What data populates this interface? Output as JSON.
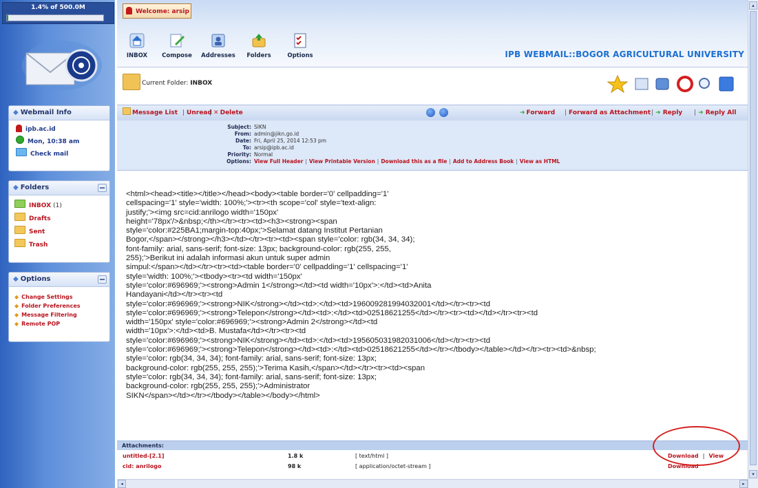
{
  "quota": {
    "text": "1.4% of 500.0M",
    "used_fraction": 0.014
  },
  "sidebar": {
    "webmail_info": {
      "title": "Webmail Info",
      "host": "ipb.ac.id",
      "datetime": "Mon, 10:38 am",
      "check_mail": "Check mail"
    },
    "folders": {
      "title": "Folders",
      "items": [
        {
          "label": "INBOX",
          "count": "(1)"
        },
        {
          "label": "Drafts"
        },
        {
          "label": "Sent"
        },
        {
          "label": "Trash"
        }
      ]
    },
    "options": {
      "title": "Options",
      "items": [
        {
          "label": "Change Settings"
        },
        {
          "label": "Folder Preferences"
        },
        {
          "label": "Message Filtering"
        },
        {
          "label": "Remote POP"
        }
      ]
    }
  },
  "header": {
    "welcome": "Welcome: arsip",
    "nav": [
      {
        "label": "INBOX",
        "icon": "house-icon"
      },
      {
        "label": "Compose",
        "icon": "compose-icon"
      },
      {
        "label": "Addresses",
        "icon": "addressbook-icon"
      },
      {
        "label": "Folders",
        "icon": "folders-icon"
      },
      {
        "label": "Options",
        "icon": "options-icon"
      }
    ],
    "university_title": "IPB WEBMAIL::BOGOR AGRICULTURAL UNIVERSITY"
  },
  "folder_bar": {
    "label": "Current Folder:",
    "folder": "INBOX"
  },
  "msg_toolbar": {
    "message_list": "Message List",
    "unread": "Unread",
    "delete": "Delete",
    "forward": "Forward",
    "forward_attachment": "Forward as Attachment",
    "reply": "Reply",
    "reply_all": "Reply All"
  },
  "msg_headers": {
    "subject_label": "Subject:",
    "subject": "SIKN",
    "from_label": "From:",
    "from": "admin@jikn.go.id",
    "date_label": "Date:",
    "date": "Fri, April 25, 2014 12:53 pm",
    "to_label": "To:",
    "to": "arsip@ipb.ac.id",
    "priority_label": "Priority:",
    "priority": "Normal",
    "options_label": "Options:",
    "options": [
      "View Full Header",
      "View Printable Version",
      "Download this as a file",
      "Add to Address Book",
      "View as HTML"
    ]
  },
  "message_body": [
    "<html><head><title></title></head><body><table border='0' cellpadding='1'",
    "cellspacing='1' style='width: 100%;'><tr><th scope='col' style='text-align:",
    "justify;'><img src=cid:anrilogo width='150px'",
    "height='78px'/>&nbsp;</th></tr><tr><td><h3><strong><span",
    "style='color:#225BA1;margin-top:40px;'>Selamat datang Institut Pertanian",
    "Bogor,</span></strong></h3></td></tr><tr><td><span style='color: rgb(34, 34, 34);",
    "font-family: arial, sans-serif; font-size: 13px; background-color: rgb(255, 255,",
    "255);'>Berikut ini adalah informasi akun untuk super admin",
    "simpul:</span></td></tr><tr><td><table border='0' cellpadding='1' cellspacing='1'",
    "style='width: 100%;'><tbody><tr><td width='150px'",
    "style='color:#696969;'><strong>Admin 1</strong></td><td width='10px'>:</td><td>Anita",
    "Handayani</td></tr><tr><td",
    "style='color:#696969;'><strong>NIK</strong></td><td>:</td><td>196009281994032001</td></tr><tr><td",
    "style='color:#696969;'><strong>Telepon</strong></td><td>:</td><td>02518621255</td></tr><tr><td></td></tr><tr><td",
    "width='150px' style='color:#696969;'><strong>Admin 2</strong></td><td",
    "width='10px'>:</td><td>B. Mustafa</td></tr><tr><td",
    "style='color:#696969;'><strong>NIK</strong></td><td>:</td><td>195605031982031006</td></tr><tr><td",
    "style='color:#696969;'><strong>Telepon</strong></td><td>:</td><td>02518621255</td></tr></tbody></table></td></tr><tr><td>&nbsp;",
    "style='color: rgb(34, 34, 34); font-family: arial, sans-serif; font-size: 13px;",
    "background-color: rgb(255, 255, 255);'>Terima Kasih,</span></td></tr><tr><td><span",
    "style='color: rgb(34, 34, 34); font-family: arial, sans-serif; font-size: 13px;",
    "background-color: rgb(255, 255, 255);'>Administrator",
    "SIKN</span></td></tr></tbody></table></body></html>"
  ],
  "attachments": {
    "title": "Attachments:",
    "items": [
      {
        "name": "untitled-[2.1]",
        "size": "1.8 k",
        "type": "[ text/html ]",
        "download": "Download",
        "view": "View"
      },
      {
        "name": "cid: anrilogo",
        "size": "98 k",
        "type": "[ application/octet-stream ]",
        "download": "Download"
      }
    ]
  },
  "colors": {
    "brand_blue": "#1c6fd0",
    "link_red": "#b8141e",
    "highlight_ellipse": "#d42020"
  }
}
